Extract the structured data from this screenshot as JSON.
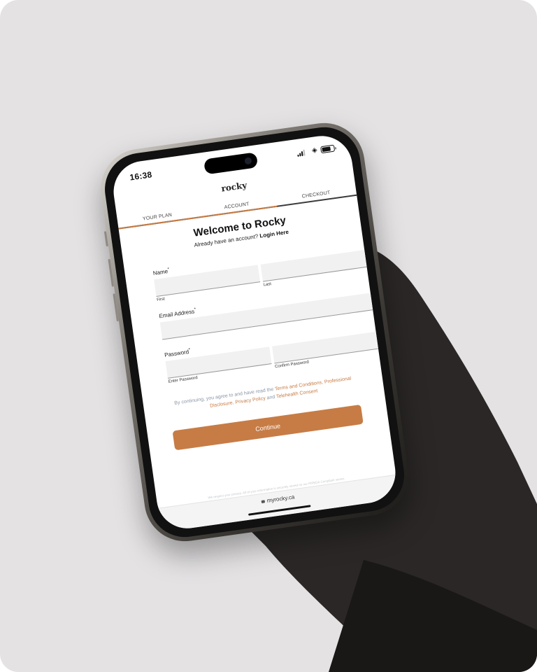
{
  "status": {
    "time": "16:38"
  },
  "brand": {
    "logo_text": "rocky"
  },
  "steps": [
    {
      "label": "YOUR PLAN"
    },
    {
      "label": "ACCOUNT"
    },
    {
      "label": "CHECKOUT"
    }
  ],
  "step_progress": 0.6667,
  "form": {
    "title": "Welcome to Rocky",
    "login_prompt": "Already have an account?",
    "login_link": "Login Here",
    "name_label": "Name",
    "first_hint": "First",
    "last_hint": "Last",
    "email_label": "Email Address",
    "password_label": "Password",
    "enter_password_hint": "Enter Password",
    "confirm_password_hint": "Confirm Password",
    "required_marker": "*"
  },
  "terms": {
    "prefix": "By continuing, you agree to and have read the",
    "link_terms": "Terms and Conditions",
    "sep1": ",",
    "link_disclosure": "Professional Disclosure",
    "sep2": ",",
    "link_privacy": "Privacy Policy",
    "and": "and",
    "link_telehealth": "Telehealth Consent"
  },
  "cta": {
    "continue_label": "Continue"
  },
  "privacy_note": "We respect your privacy. All of your information is securely stored on our PIPEDA Compliant server.",
  "browser": {
    "url": "myrocky.ca"
  },
  "colors": {
    "accent": "#c77c45",
    "background": "#e4e2e3",
    "field": "#f1f1f1"
  }
}
